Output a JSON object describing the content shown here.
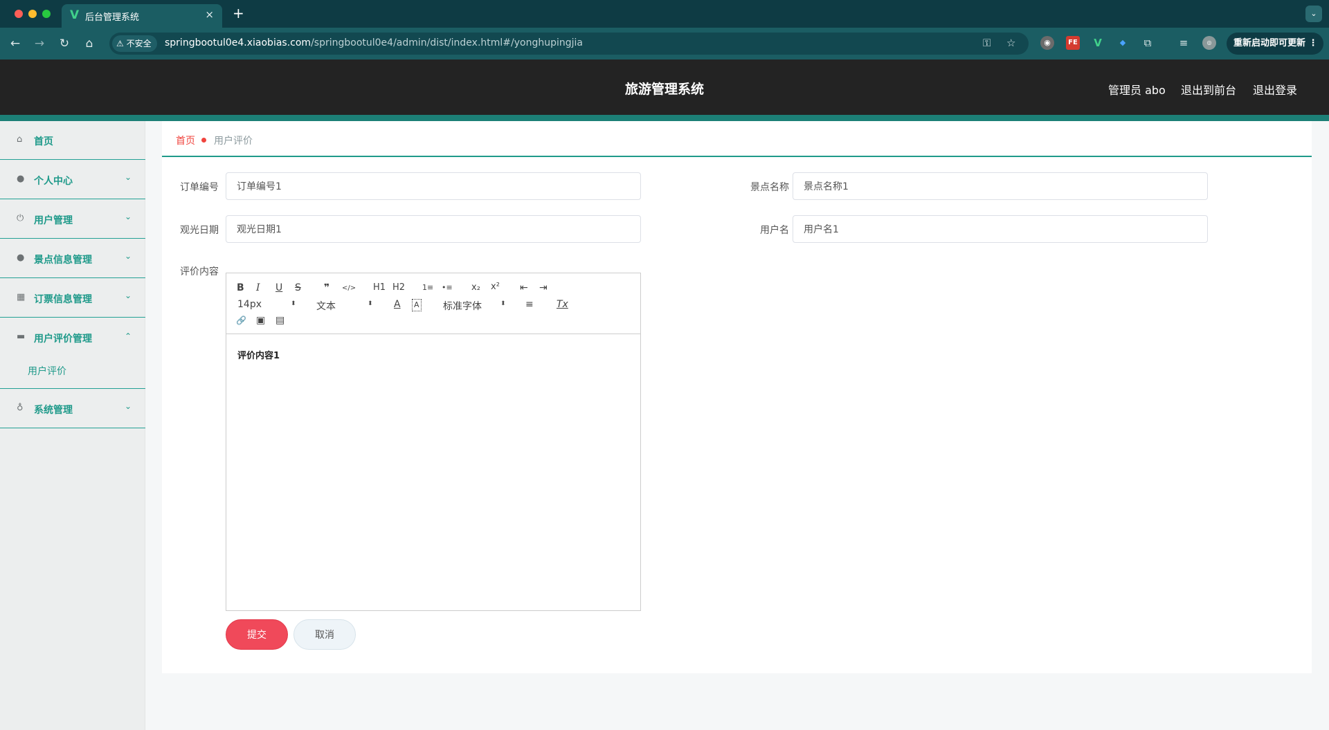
{
  "browser": {
    "tab_title": "后台管理系统",
    "tab_logo": "V",
    "tab_close": "×",
    "new_tab": "+",
    "insecure_label": "不安全",
    "url_host": "springbootul0e4.xiaobias.com",
    "url_path": "/springbootul0e4/admin/dist/index.html#/yonghupingjia",
    "restart_label": "重新启动即可更新",
    "extensions": [
      "FE",
      "V"
    ]
  },
  "header": {
    "title": "旅游管理系统",
    "user_label": "管理员 abo",
    "to_front": "退出到前台",
    "logout": "退出登录"
  },
  "sidebar": {
    "items": [
      {
        "label": "首页",
        "icon": "home-icon"
      },
      {
        "label": "个人中心",
        "icon": "person-icon"
      },
      {
        "label": "用户管理",
        "icon": "power-icon"
      },
      {
        "label": "景点信息管理",
        "icon": "user-icon"
      },
      {
        "label": "订票信息管理",
        "icon": "grid-icon"
      },
      {
        "label": "用户评价管理",
        "icon": "monitor-icon",
        "expanded": true
      },
      {
        "label": "系统管理",
        "icon": "mic-icon"
      }
    ],
    "submenu": {
      "label": "用户评价"
    }
  },
  "breadcrumb": {
    "home": "首页",
    "current": "用户评价"
  },
  "form": {
    "order_no": {
      "label": "订单编号",
      "value": "订单编号1"
    },
    "spot_name": {
      "label": "景点名称",
      "value": "景点名称1"
    },
    "visit_date": {
      "label": "观光日期",
      "value": "观光日期1"
    },
    "username": {
      "label": "用户名",
      "value": "用户名1"
    },
    "content": {
      "label": "评价内容",
      "value": "评价内容1"
    }
  },
  "editor_toolbar": {
    "bold": "B",
    "italic": "I",
    "underline": "U",
    "strike": "S",
    "blockquote": "❞",
    "code": "</>",
    "h1": "H1",
    "h2": "H2",
    "ordered_list": "1≡",
    "bullet_list": "•≡",
    "subscript": "x₂",
    "superscript": "x²",
    "outdent": "⇤",
    "indent": "⇥",
    "size": "14px",
    "header_select": "文本",
    "font_color": "A",
    "background_color": "A",
    "font": "标准字体",
    "align": "≡",
    "clean": "Tx",
    "link": "🔗",
    "image": "▣",
    "video": "▤"
  },
  "buttons": {
    "submit": "提交",
    "cancel": "取消"
  },
  "colors": {
    "accent": "#1f9a8a",
    "header_bg": "#232323",
    "submit": "#f0495a",
    "breadcrumb_home": "#f0443e"
  }
}
